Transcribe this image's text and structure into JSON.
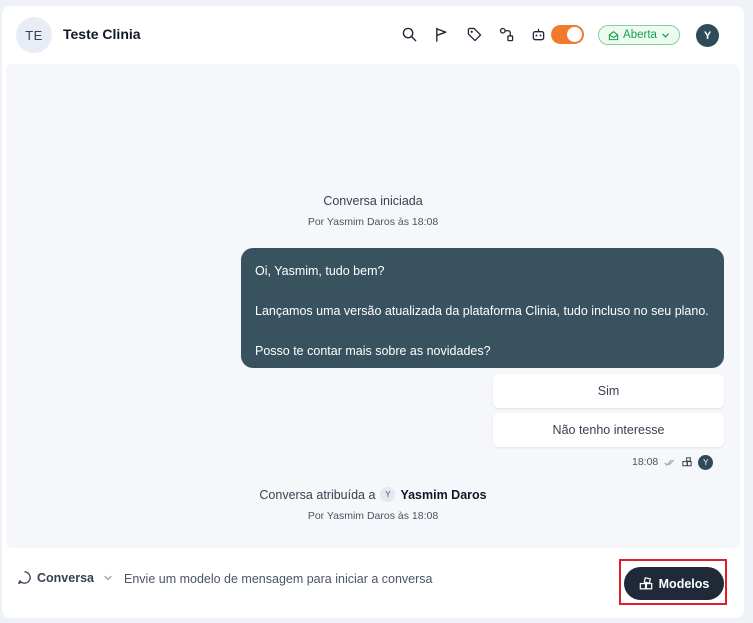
{
  "header": {
    "avatar_initials": "TE",
    "contact_name": "Teste Clinia",
    "status_label": "Aberta",
    "user_initial": "Y",
    "toggle_on": true
  },
  "chat": {
    "start_event": {
      "title": "Conversa iniciada",
      "subtitle": "Por Yasmim Daros às 18:08"
    },
    "message": {
      "line1": "Oi, Yasmim, tudo bem?",
      "line2": "Lançamos uma versão atualizada da plataforma Clinia, tudo incluso no seu plano.",
      "line3": "Posso te contar mais sobre as novidades?",
      "time": "18:08",
      "sender_initial": "Y"
    },
    "quick_replies": [
      "Sim",
      "Não tenho interesse"
    ],
    "assign_event": {
      "prefix": "Conversa atribuída a",
      "user_initial": "Y",
      "assignee": "Yasmim Daros",
      "subtitle": "Por Yasmim Daros às 18:08"
    }
  },
  "footer": {
    "channel_label": "Conversa",
    "hint": "Envie um modelo de mensagem para iniciar a conversa",
    "templates_button": "Modelos"
  },
  "colors": {
    "bubble": "#38535f",
    "toggle": "#f07b2f",
    "status_green": "#16a34a",
    "highlight": "#e11d2a",
    "button_dark": "#1f2937"
  }
}
